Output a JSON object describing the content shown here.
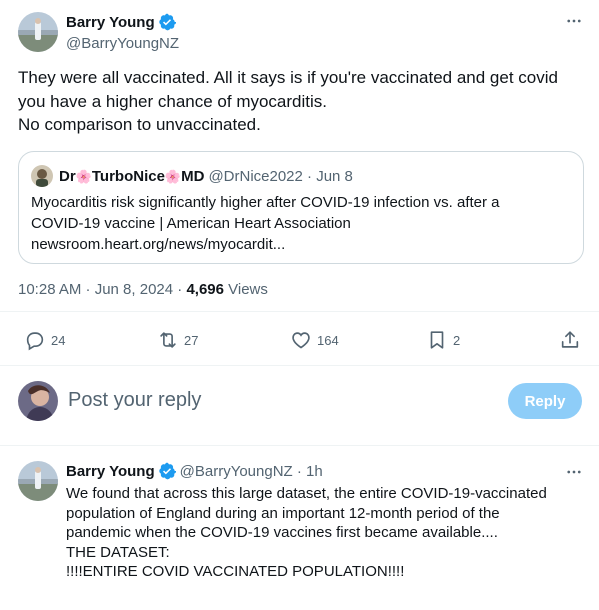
{
  "main_tweet": {
    "display_name": "Barry Young",
    "handle": "@BarryYoungNZ",
    "text_lines": [
      "They were all vaccinated. All it says is if you're vaccinated and get covid",
      "you have a higher chance of myocarditis.",
      "No comparison to unvaccinated."
    ],
    "quote": {
      "name_part1": "Dr",
      "name_part2": "TurboNice",
      "name_part3": "MD",
      "flower": "🌸",
      "handle_date": "@DrNice2022 · Jun 8",
      "text_lines": [
        "Myocarditis risk significantly higher after COVID-19 infection vs. after a",
        "COVID-19 vaccine | American Heart Association",
        "newsroom.heart.org/news/myocardit..."
      ]
    },
    "timestamp": "10:28 AM · Jun 8, 2024 · ",
    "views_count": "4,696",
    "views_label": " Views",
    "actions": {
      "replies": "24",
      "reposts": "27",
      "likes": "164",
      "bookmarks": "2"
    }
  },
  "reply_composer": {
    "placeholder": "Post your reply",
    "button_label": "Reply"
  },
  "reply_tweet": {
    "display_name": "Barry Young",
    "handle_time": "@BarryYoungNZ · 1h",
    "text_lines": [
      "We found that across this large dataset, the entire COVID-19-vaccinated",
      "population of England during an important 12-month period of the",
      "pandemic when the COVID-19 vaccines first became available....",
      "THE DATASET:",
      "!!!!ENTIRE COVID VACCINATED POPULATION!!!!"
    ]
  },
  "colors": {
    "verified": "#1d9bf0",
    "reply_button_disabled": "#8ecdf8",
    "secondary_text": "#536471",
    "border": "#cfd9de"
  }
}
